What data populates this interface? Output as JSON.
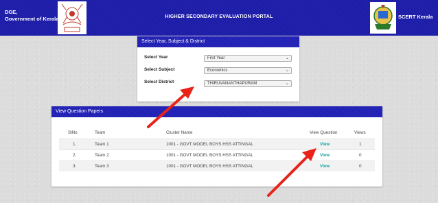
{
  "header": {
    "org_line1": "DGE,",
    "org_line2": "Government of Kerala",
    "title": "HIGHER SECONDARY EVALUATION PORTAL",
    "right_label": "SCERT Kerala",
    "color": "#1b1ba8"
  },
  "selector": {
    "heading": "Select Year, Subject & District",
    "year_label": "Select Year",
    "year_value": "First Year",
    "subject_label": "Select Subject",
    "subject_value": "Economics",
    "district_label": "Select District",
    "district_value": "THIRUVANANTHAPURAM"
  },
  "papers": {
    "heading": "View Question Papers",
    "columns": [
      "SlNo",
      "Team",
      "Cluster Name",
      "View Question",
      "Views"
    ],
    "rows": [
      {
        "slno": "1.",
        "team": "Team 1",
        "cluster": "1001 - GOVT MODEL BOYS HSS ATTINGAL",
        "view": "View",
        "views": "1"
      },
      {
        "slno": "2.",
        "team": "Team 2",
        "cluster": "1001 - GOVT MODEL BOYS HSS ATTINGAL",
        "view": "View",
        "views": "0"
      },
      {
        "slno": "3.",
        "team": "Team 3",
        "cluster": "1001 - GOVT MODEL BOYS HSS ATTINGAL",
        "view": "View",
        "views": "0"
      }
    ]
  },
  "annotation_color": "#e8241a"
}
